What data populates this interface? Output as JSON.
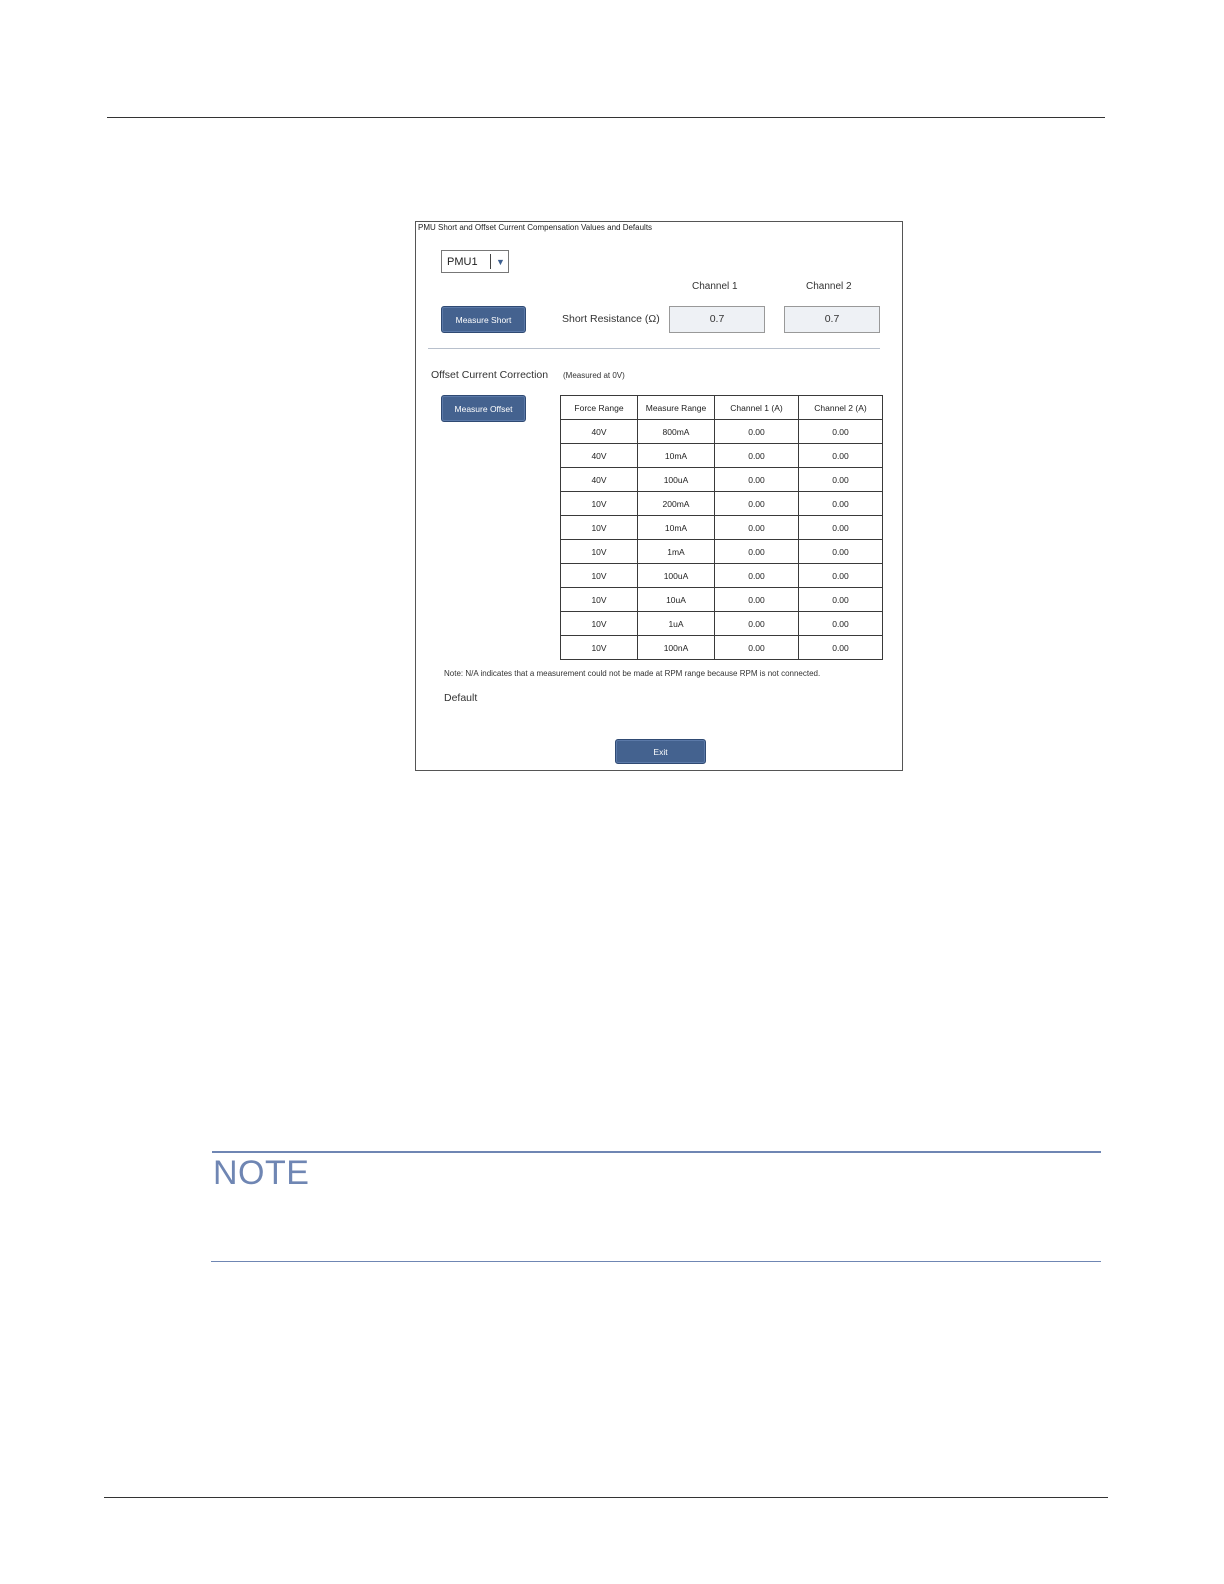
{
  "dialog": {
    "title": "PMU Short and Offset Current Compensation Values and Defaults",
    "unit_select": {
      "value": "PMU1"
    },
    "channel_headers": [
      "Channel 1",
      "Channel 2"
    ],
    "measure_short_label": "Measure Short",
    "short_resistance_label": "Short Resistance (Ω)",
    "short_resistance_values": [
      "0.7",
      "0.7"
    ],
    "offset_section_label": "Offset Current Correction",
    "offset_section_note": "(Measured at 0V)",
    "measure_offset_label": "Measure Offset",
    "table": {
      "headers": [
        "Force Range",
        "Measure Range",
        "Channel 1 (A)",
        "Channel 2 (A)"
      ],
      "rows": [
        [
          "40V",
          "800mA",
          "0.00",
          "0.00"
        ],
        [
          "40V",
          "10mA",
          "0.00",
          "0.00"
        ],
        [
          "40V",
          "100uA",
          "0.00",
          "0.00"
        ],
        [
          "10V",
          "200mA",
          "0.00",
          "0.00"
        ],
        [
          "10V",
          "10mA",
          "0.00",
          "0.00"
        ],
        [
          "10V",
          "1mA",
          "0.00",
          "0.00"
        ],
        [
          "10V",
          "100uA",
          "0.00",
          "0.00"
        ],
        [
          "10V",
          "10uA",
          "0.00",
          "0.00"
        ],
        [
          "10V",
          "1uA",
          "0.00",
          "0.00"
        ],
        [
          "10V",
          "100nA",
          "0.00",
          "0.00"
        ]
      ]
    },
    "footnote": "Note: N/A indicates that a measurement could not be made at RPM range because RPM is not connected.",
    "default_label": "Default",
    "exit_label": "Exit"
  },
  "note_box": {
    "title": "NOTE",
    "color": "#6f86b3"
  },
  "accent_color": "#44628f"
}
